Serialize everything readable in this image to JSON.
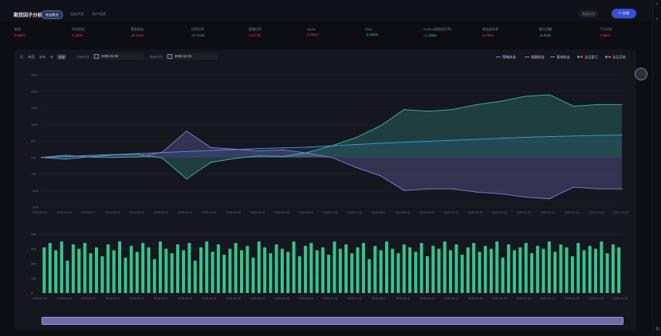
{
  "header": {
    "title": "期货因子分析",
    "tabs": [
      {
        "label": "收益概览",
        "active": true
      },
      {
        "label": "风险评估",
        "active": false
      },
      {
        "label": "账户信息",
        "active": false
      }
    ],
    "ghost_button": "策略回测",
    "primary_button": "分析"
  },
  "metrics": [
    {
      "label": "收益",
      "value": "8.59%",
      "color": "#e8435f"
    },
    {
      "label": "年化收益",
      "value": "7.10%",
      "color": "#e8435f"
    },
    {
      "label": "基准收益",
      "value": "16.12%",
      "color": "#e8435f"
    },
    {
      "label": "信息比率",
      "value": "-0.7126",
      "color": "#2ec08a"
    },
    {
      "label": "夏普比率",
      "value": "0.4778",
      "color": "#e8435f"
    },
    {
      "label": "Alpha",
      "value": "0.0317",
      "color": "#e8435f"
    },
    {
      "label": "Beta",
      "value": "-0.0808",
      "color": "#2ec08a"
    },
    {
      "label": "Sortino(索提诺比率)",
      "value": "-1.1568",
      "color": "#2ec08a"
    },
    {
      "label": "收益波动率",
      "value": "5.73%",
      "color": "#e8435f"
    },
    {
      "label": "最大回撤",
      "value": "-5.03%",
      "color": "#2ec08a"
    },
    {
      "label": "下行风险",
      "value": "7.58%",
      "color": "#e8435f"
    }
  ],
  "controls": {
    "periods": [
      "月",
      "季度",
      "半年",
      "年",
      "全部"
    ],
    "selected_period": "全部",
    "start_label": "开始时间",
    "start_date": "2025-01-02",
    "end_label": "结束时间",
    "end_date": "2025-12-31"
  },
  "legend": [
    {
      "label": "策略收益",
      "color": "#3aa0e6",
      "kind": "line"
    },
    {
      "label": "超额收益",
      "color": "#8a7bd8",
      "kind": "line"
    },
    {
      "label": "基准收益",
      "color": "#3fb9a1",
      "kind": "line"
    },
    {
      "label": "当日盈亏",
      "color": "#e8435f",
      "kind": "dot"
    },
    {
      "label": "当日买卖",
      "color": "#e8435f",
      "kind": "dot"
    }
  ],
  "chart_data": [
    {
      "type": "area",
      "ylim": [
        -15,
        25
      ],
      "y_ticks": [
        "25%",
        "20%",
        "15%",
        "10%",
        "5%",
        "0%",
        "-5%",
        "-10%",
        "-15%"
      ],
      "x_ticks": [
        "2025-01-02",
        "2025-01-16",
        "2025-02-07",
        "2025-02-21",
        "2025-03-07",
        "2025-03-21",
        "2025-04-07",
        "2025-04-21",
        "2025-05-08",
        "2025-05-22",
        "2025-06-06",
        "2025-06-20",
        "2025-07-04",
        "2025-07-18",
        "2025-08-01",
        "2025-08-15",
        "2025-08-29",
        "2025-09-12",
        "2025-09-26",
        "2025-10-15",
        "2025-11-03",
        "2025-11-17",
        "2025-12-01",
        "2025-12-15",
        "2025-12-29"
      ],
      "series": [
        {
          "name": "策略收益",
          "color": "#3aa0e6",
          "values": [
            0,
            0.3,
            0.6,
            0.9,
            1.2,
            1.5,
            1.8,
            2.1,
            2.4,
            2.7,
            2.9,
            3.1,
            3.5,
            3.9,
            4.3,
            4.6,
            4.9,
            5.2,
            5.5,
            5.8,
            6.1,
            6.3,
            6.5,
            6.7,
            6.8
          ]
        },
        {
          "name": "基准收益",
          "color": "#3fb9a1",
          "values": [
            0,
            -0.5,
            0.2,
            0.8,
            1.0,
            -0.2,
            -6.5,
            -1.5,
            -0.3,
            0.5,
            0.3,
            1.5,
            3.5,
            6.0,
            9.5,
            14.5,
            14.0,
            14.5,
            16.0,
            17.0,
            18.5,
            19.0,
            15.5,
            16.0,
            16.0
          ]
        },
        {
          "name": "超额收益",
          "color": "#8a7bd8",
          "values": [
            0,
            0.7,
            0.1,
            0.0,
            0.2,
            1.6,
            8.0,
            3.0,
            2.5,
            2.0,
            2.3,
            1.3,
            0.0,
            -3.0,
            -5.5,
            -10.0,
            -9.5,
            -9.5,
            -10.5,
            -11.0,
            -12.0,
            -12.5,
            -9.0,
            -9.5,
            -9.5
          ]
        }
      ]
    },
    {
      "type": "bar",
      "ylim": [
        0,
        40
      ],
      "y_ticks": [
        "40k",
        "30k",
        "20k",
        "10k",
        "0"
      ],
      "x_ticks": [
        "2025-01-02",
        "2025-01-16",
        "2025-02-07",
        "2025-02-21",
        "2025-03-07",
        "2025-03-21",
        "2025-04-07",
        "2025-04-21",
        "2025-05-08",
        "2025-05-22",
        "2025-06-06",
        "2025-06-20",
        "2025-07-04",
        "2025-07-18",
        "2025-08-01",
        "2025-08-15",
        "2025-08-29",
        "2025-09-12",
        "2025-09-26",
        "2025-10-15",
        "2025-11-03",
        "2025-11-17",
        "2025-12-01",
        "2025-12-15",
        "2025-12-31"
      ],
      "series": [
        {
          "color": "#35c48e",
          "values": [
            31,
            34,
            29,
            35,
            22,
            33,
            30,
            34,
            27,
            31,
            25,
            33,
            29,
            35,
            24,
            32,
            28,
            34,
            31,
            23,
            35,
            30,
            27,
            33,
            29,
            34,
            22,
            31,
            35,
            28,
            33,
            26,
            30,
            34,
            29,
            32,
            24,
            35,
            31,
            27,
            33,
            30,
            28,
            35,
            25,
            32,
            34,
            29,
            31,
            26,
            35,
            30,
            33,
            27,
            31,
            34,
            23,
            32,
            29,
            35,
            30,
            27,
            33,
            31,
            28,
            34,
            25,
            32,
            30,
            35,
            29,
            33,
            26,
            31,
            34,
            28,
            32,
            30,
            35,
            24,
            33,
            29,
            31,
            34,
            27,
            32,
            30,
            35,
            28,
            33,
            31,
            25,
            34,
            29,
            32,
            30,
            35,
            27,
            33,
            31
          ]
        }
      ]
    }
  ]
}
